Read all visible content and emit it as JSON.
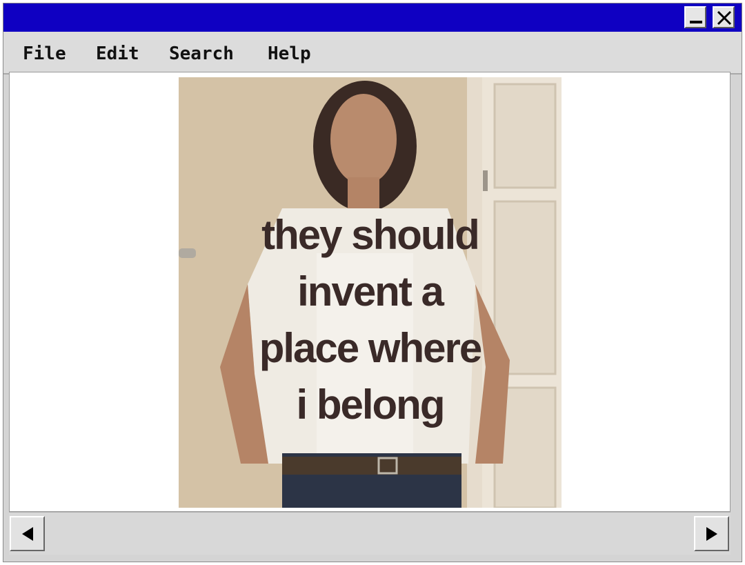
{
  "window": {
    "title": "",
    "minimize_icon": "minimize-icon",
    "close_icon": "close-icon",
    "titlebar_color": "#0f00c2"
  },
  "menu": {
    "items": [
      "File",
      "Edit",
      "Search",
      "Help"
    ]
  },
  "image": {
    "description_icon": "photo-image",
    "caption_lines": [
      "they should",
      "invent a",
      "place where",
      "i belong"
    ]
  },
  "scrollbar": {
    "left_icon": "arrow-left-icon",
    "right_icon": "arrow-right-icon"
  }
}
